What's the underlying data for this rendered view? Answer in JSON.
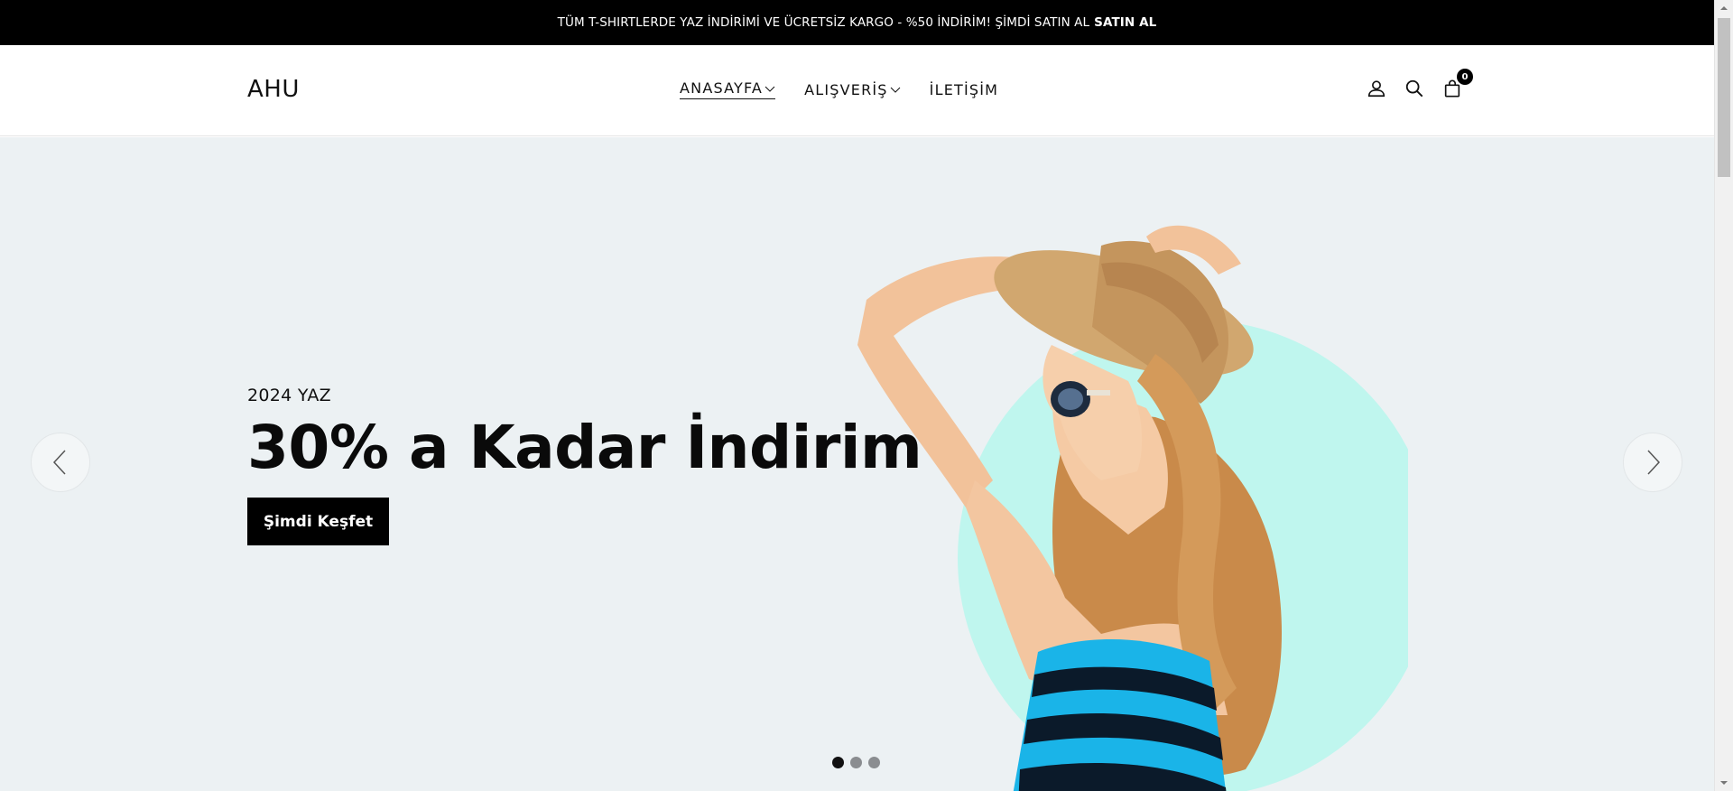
{
  "announcement": {
    "text": "TÜM T-SHIRTLERDE YAZ İNDİRİMİ VE ÜCRETSİZ KARGO - %50 İNDİRİM! ŞİMDİ SATIN AL",
    "link": "SATIN AL"
  },
  "header": {
    "logo": "AHU",
    "nav": [
      {
        "label": "ANASAYFA",
        "dropdown": true,
        "active": true
      },
      {
        "label": "ALIŞVERİŞ",
        "dropdown": true,
        "active": false
      },
      {
        "label": "İLETİŞİM",
        "dropdown": false,
        "active": false
      }
    ],
    "icons": [
      "user-icon",
      "search-icon",
      "shopping-bag-icon"
    ],
    "cart_count": "0"
  },
  "hero": {
    "subtitle": "2024 YAZ",
    "title": "30% a Kadar İndirim",
    "button": "Şimdi Keşfet",
    "image": "woman-in-straw-hat-and-sunglasses",
    "slides_total": 3,
    "active_slide": 1
  },
  "colors": {
    "announcement_bg": "#000000",
    "hero_bg": "#ecf1f3",
    "circle": "#bff6ee",
    "button_bg": "#000000"
  }
}
